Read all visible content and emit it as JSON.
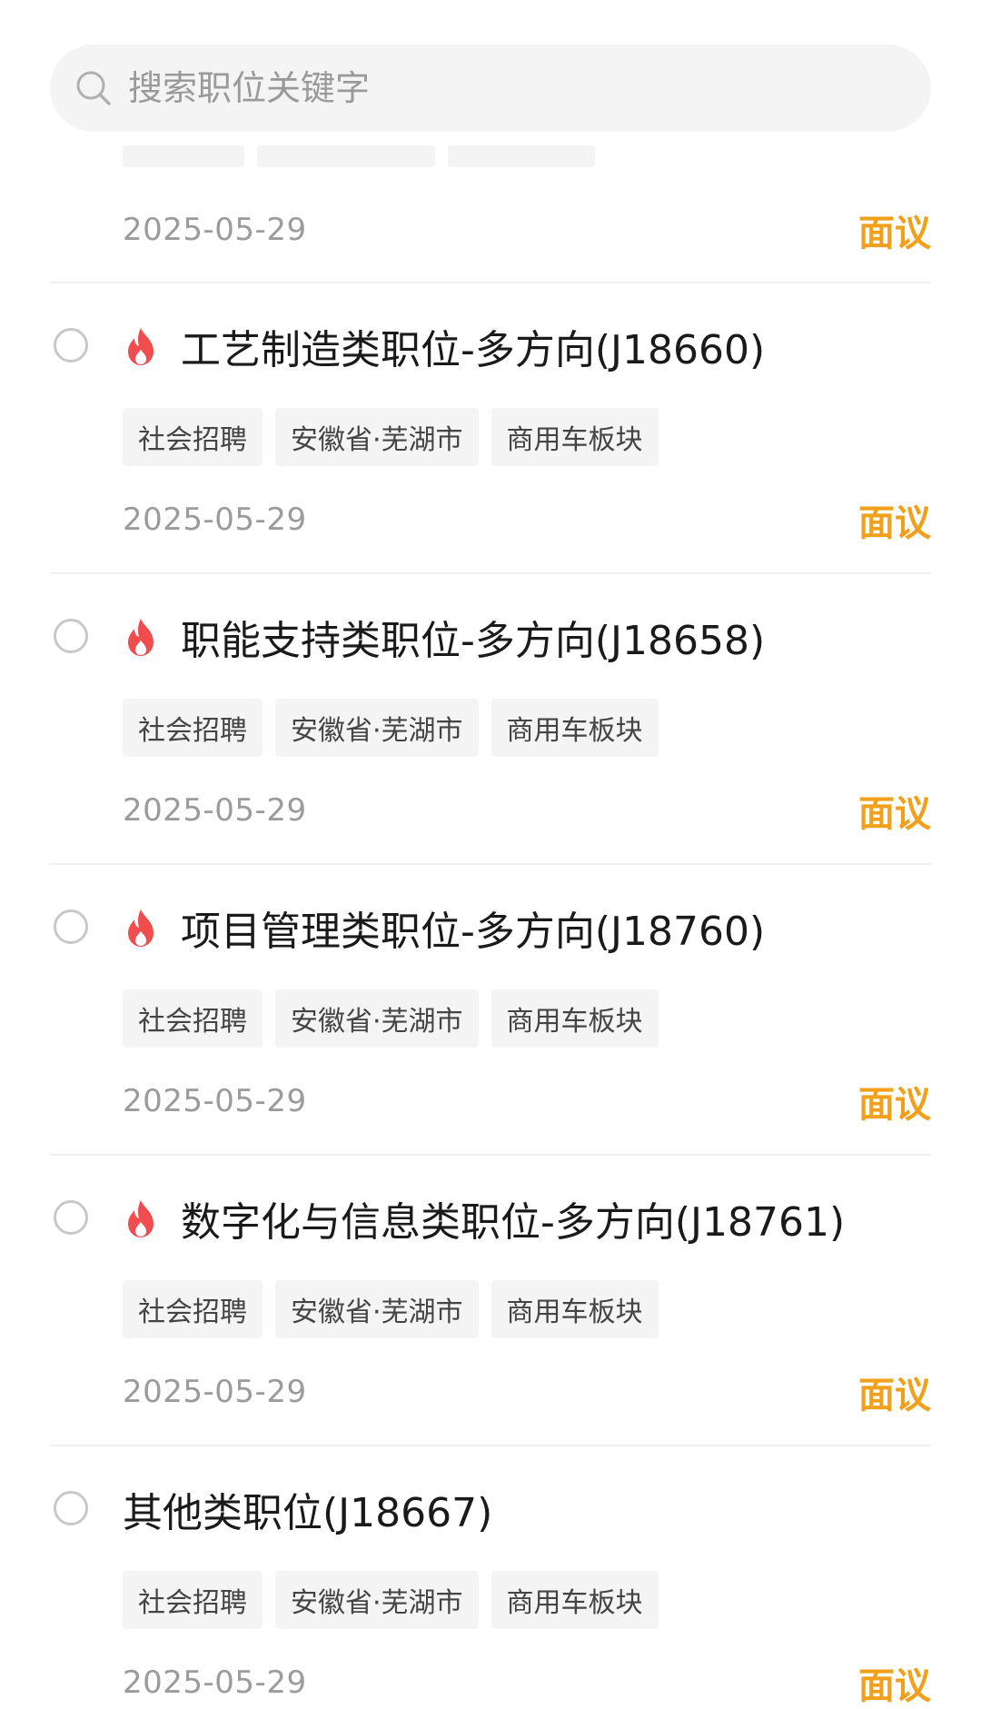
{
  "search": {
    "placeholder": "搜索职位关键字"
  },
  "colors": {
    "accent_salary": "#f0a01a",
    "hot_icon": "#f04e4e",
    "chip_bg": "#f4f4f4"
  },
  "partial_item": {
    "date": "2025-05-29",
    "salary": "面议"
  },
  "jobs": [
    {
      "hot": true,
      "title": "工艺制造类职位-多方向(J18660)",
      "tags": [
        "社会招聘",
        "安徽省·芜湖市",
        "商用车板块"
      ],
      "date": "2025-05-29",
      "salary": "面议"
    },
    {
      "hot": true,
      "title": "职能支持类职位-多方向(J18658)",
      "tags": [
        "社会招聘",
        "安徽省·芜湖市",
        "商用车板块"
      ],
      "date": "2025-05-29",
      "salary": "面议"
    },
    {
      "hot": true,
      "title": "项目管理类职位-多方向(J18760)",
      "tags": [
        "社会招聘",
        "安徽省·芜湖市",
        "商用车板块"
      ],
      "date": "2025-05-29",
      "salary": "面议"
    },
    {
      "hot": true,
      "title": "数字化与信息类职位-多方向(J18761)",
      "tags": [
        "社会招聘",
        "安徽省·芜湖市",
        "商用车板块"
      ],
      "date": "2025-05-29",
      "salary": "面议"
    },
    {
      "hot": false,
      "title": "其他类职位(J18667)",
      "tags": [
        "社会招聘",
        "安徽省·芜湖市",
        "商用车板块"
      ],
      "date": "2025-05-29",
      "salary": "面议"
    }
  ]
}
